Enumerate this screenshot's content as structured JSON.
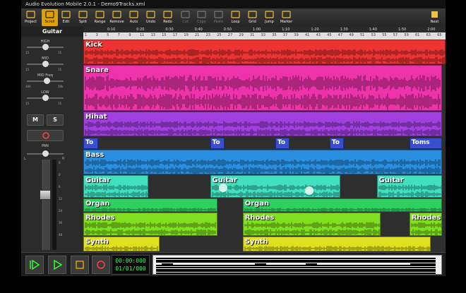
{
  "window": {
    "title": "Audio Evolution Mobile 2.0.1 - Demo9Tracks.xml"
  },
  "toolbar": {
    "buttons": [
      {
        "label": "Project",
        "icon": "folder-icon",
        "state": "normal"
      },
      {
        "label": "Scroll",
        "icon": "scroll-icon",
        "state": "active"
      },
      {
        "label": "Edit",
        "icon": "edit-icon",
        "state": "normal"
      },
      {
        "label": "Split",
        "icon": "split-icon",
        "state": "normal"
      },
      {
        "label": "Range",
        "icon": "range-icon",
        "state": "normal"
      },
      {
        "label": "Remove",
        "icon": "remove-icon",
        "state": "normal"
      },
      {
        "label": "Auto",
        "icon": "automation-icon",
        "state": "normal"
      },
      {
        "label": "Undo",
        "icon": "undo-icon",
        "state": "normal"
      },
      {
        "label": "Redo",
        "icon": "redo-icon",
        "state": "normal"
      },
      {
        "label": "Cut",
        "icon": "cut-icon",
        "state": "disabled"
      },
      {
        "label": "Copy",
        "icon": "copy-icon",
        "state": "disabled"
      },
      {
        "label": "Paste",
        "icon": "paste-icon",
        "state": "disabled"
      },
      {
        "label": "Loop",
        "icon": "loop-icon",
        "state": "normal"
      },
      {
        "label": "Grid",
        "icon": "grid-icon",
        "state": "normal"
      },
      {
        "label": "Jump",
        "icon": "jump-icon",
        "state": "normal"
      },
      {
        "label": "Marker",
        "icon": "marker-icon",
        "state": "normal"
      }
    ],
    "next_label": "Next"
  },
  "channel": {
    "track_name": "Guitar",
    "eq": [
      {
        "name": "HIGH",
        "min": "15",
        "max": "15",
        "value": 0.5
      },
      {
        "name": "MID",
        "min": "15",
        "max": "15",
        "value": 0.5
      },
      {
        "name": "MID Freq",
        "min": "300",
        "max": "20k",
        "value": 0.55
      },
      {
        "name": "LOW",
        "min": "15",
        "max": "15",
        "value": 0.5
      }
    ],
    "mute_label": "M",
    "solo_label": "S",
    "pan_label": "PAN",
    "pan_left": "L",
    "pan_right": "R",
    "pan_value": 0.5,
    "fader_level": 0.62,
    "meter_marks": [
      "6",
      "0",
      "6",
      "12",
      "24",
      "36",
      "48"
    ]
  },
  "timeline": {
    "time_ticks": [
      "0:10",
      "0:20",
      "0:30",
      "0:40",
      "0:50",
      "1:00",
      "1:10",
      "1:20",
      "1:30",
      "1:40",
      "1:50",
      "2:00"
    ],
    "bar_ticks": [
      "1",
      "3",
      "5",
      "7",
      "9",
      "11",
      "13",
      "15",
      "17",
      "19",
      "21",
      "23",
      "25",
      "27",
      "29",
      "31",
      "33",
      "35",
      "37",
      "39",
      "41",
      "43",
      "45",
      "47",
      "49",
      "51",
      "53",
      "55",
      "57",
      "59",
      "61",
      "63",
      "65"
    ]
  },
  "tracks": [
    {
      "name": "Kick",
      "color": "#ee3333",
      "clips": [
        {
          "label": "Kick",
          "start": 0.0,
          "end": 1.0
        }
      ]
    },
    {
      "name": "Snare",
      "color": "#ee33aa",
      "clips": [
        {
          "label": "Snare",
          "start": 0.0,
          "end": 0.99
        }
      ]
    },
    {
      "name": "Hihat",
      "color": "#a040e0",
      "clips": [
        {
          "label": "Hihat",
          "start": 0.0,
          "end": 0.99
        }
      ]
    },
    {
      "name": "Toms",
      "color": "#3a4fd0",
      "clips": [
        {
          "label": "To",
          "start": 0.0,
          "end": 0.04
        },
        {
          "label": "To",
          "start": 0.35,
          "end": 0.39
        },
        {
          "label": "To",
          "start": 0.53,
          "end": 0.57
        },
        {
          "label": "To",
          "start": 0.68,
          "end": 0.72
        },
        {
          "label": "Toms",
          "start": 0.9,
          "end": 0.99
        }
      ]
    },
    {
      "name": "Bass",
      "color": "#2a8fe0",
      "clips": [
        {
          "label": "Bass",
          "start": 0.0,
          "end": 0.99
        }
      ]
    },
    {
      "name": "Guitar",
      "color": "#40e0c0",
      "clips": [
        {
          "label": "Guitar",
          "start": 0.0,
          "end": 0.18
        },
        {
          "label": "Guitar",
          "start": 0.35,
          "end": 0.71
        },
        {
          "label": "Guitar",
          "start": 0.81,
          "end": 0.99
        }
      ]
    },
    {
      "name": "Organ",
      "color": "#30d060",
      "clips": [
        {
          "label": "Organ",
          "start": 0.0,
          "end": 0.37
        },
        {
          "label": "Organ",
          "start": 0.44,
          "end": 0.99
        }
      ]
    },
    {
      "name": "Rhodes",
      "color": "#80e020",
      "clips": [
        {
          "label": "Rhodes",
          "start": 0.0,
          "end": 0.37
        },
        {
          "label": "Rhodes",
          "start": 0.44,
          "end": 0.82
        },
        {
          "label": "Rhodes",
          "start": 0.9,
          "end": 0.99
        }
      ]
    },
    {
      "name": "Synth",
      "color": "#e0e020",
      "clips": [
        {
          "label": "Synth",
          "start": 0.0,
          "end": 0.21
        },
        {
          "label": "Synth",
          "start": 0.44,
          "end": 0.96
        }
      ]
    }
  ],
  "transport": {
    "buttons": [
      {
        "name": "play-from-start-button",
        "icon": "play-from-start-icon"
      },
      {
        "name": "play-button",
        "icon": "play-icon"
      },
      {
        "name": "stop-button",
        "icon": "stop-icon"
      },
      {
        "name": "record-button",
        "icon": "record-icon"
      }
    ],
    "time": "00:00:000",
    "date": "01/01/000"
  },
  "colors": {
    "accent": "#e0a000",
    "clock": "#2cff5a",
    "record": "#ff4040",
    "play": "#30ff30"
  }
}
